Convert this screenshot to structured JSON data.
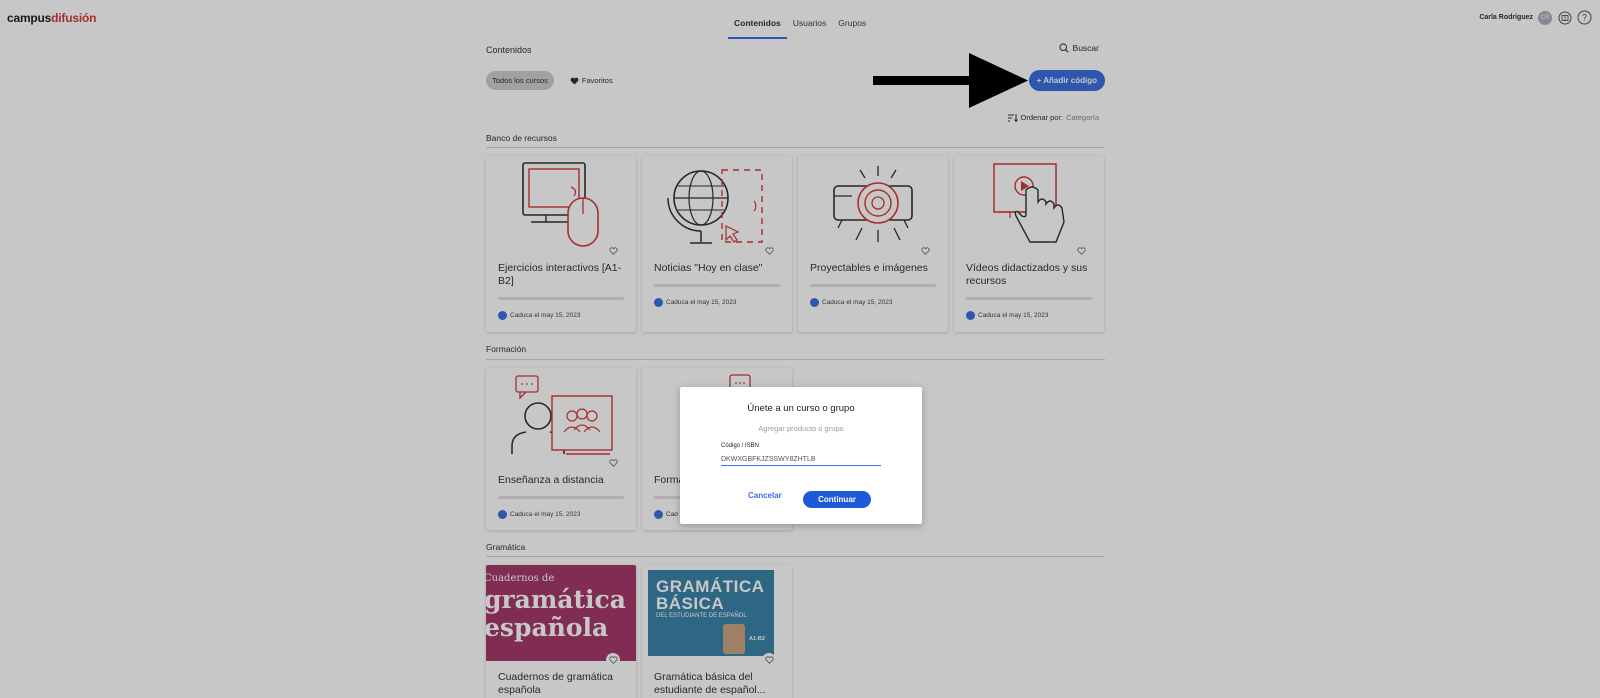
{
  "brand": {
    "part1": "campus",
    "part2": "difusión"
  },
  "nav": {
    "tabs": [
      "Contenidos",
      "Usuarios",
      "Grupos"
    ],
    "active": "Contenidos"
  },
  "user": {
    "name": "Carla Rodríguez",
    "initials": "CR"
  },
  "page": {
    "title": "Contenidos",
    "search_label": "Buscar",
    "filters": [
      "Todos los cursos",
      "Favoritos"
    ],
    "add_code_label": "+ Añadir código",
    "sort_label": "Ordenar por:",
    "sort_value": "Categoría"
  },
  "sections": [
    {
      "title": "Banco de recursos",
      "cards": [
        {
          "title": "Ejercicios interactivos [A1-B2]",
          "expiry": "Caduca el may 15, 2023",
          "icon": "computer-mouse-icon"
        },
        {
          "title": "Noticias \"Hoy en clase\"",
          "expiry": "Caduca el may 15, 2023",
          "icon": "globe-icon"
        },
        {
          "title": "Proyectables e imágenes",
          "expiry": "Caduca el may 15, 2023",
          "icon": "projector-icon"
        },
        {
          "title": "Vídeos didactizados y sus recursos",
          "expiry": "Caduca el may 15, 2023",
          "icon": "video-touch-icon"
        }
      ]
    },
    {
      "title": "Formación",
      "cards": [
        {
          "title": "Enseñanza a distancia",
          "expiry": "Caduca el may 15, 2023",
          "icon": "remote-teaching-icon"
        },
        {
          "title": "Forma",
          "expiry": "Cad",
          "icon": "chat-bubble-icon"
        }
      ]
    },
    {
      "title": "Gramática",
      "cards": [
        {
          "title": "Cuadernos de gramática española",
          "cover_lines": [
            "Cuadernos de",
            "gramática",
            "española"
          ]
        },
        {
          "title": "Gramática básica del estudiante de español...",
          "cover_lines": [
            "GRAMÁTICA",
            "BÁSICA",
            "DEL ESTUDIANTE DE ESPAÑOL",
            "A1-B2"
          ]
        }
      ]
    }
  ],
  "modal": {
    "title": "Únete a un curso o grupo",
    "subtitle": "Agregar producto o grupo",
    "field_label": "Código / ISBN",
    "field_value": "DKWXGBFKJZSSWY8ZHTLB",
    "cancel_label": "Cancelar",
    "continue_label": "Continuar"
  },
  "colors": {
    "accent": "#3b6fe0",
    "brand_red": "#d63a3a",
    "overlay": "rgba(0,0,0,0.22)"
  }
}
